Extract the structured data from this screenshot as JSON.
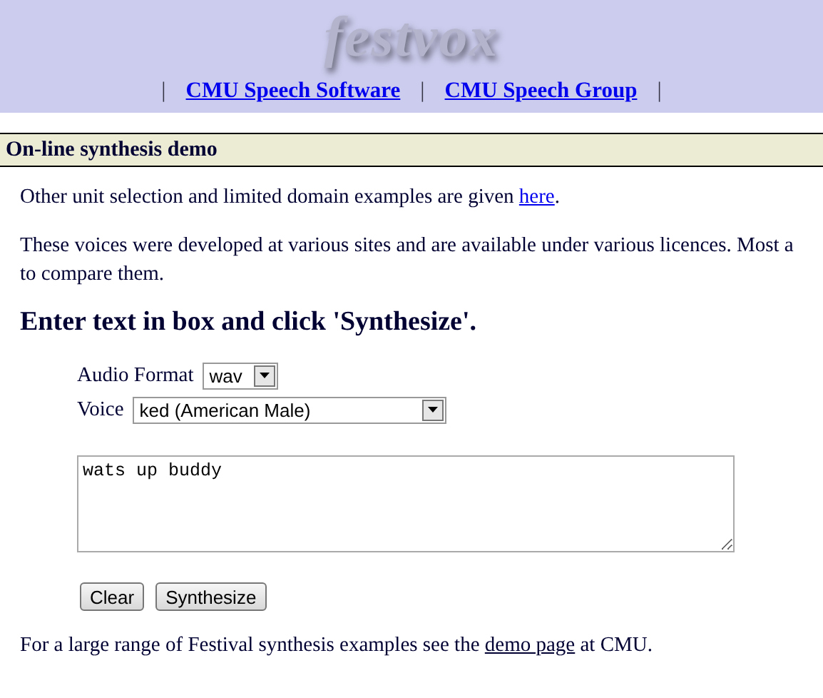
{
  "header": {
    "logo": "festvox",
    "nav": [
      {
        "kind": "separator",
        "text": "|"
      },
      {
        "kind": "link",
        "text": "CMU Speech Software"
      },
      {
        "kind": "separator",
        "text": "|"
      },
      {
        "kind": "link",
        "text": "CMU Speech Group"
      },
      {
        "kind": "separator",
        "text": "|"
      }
    ]
  },
  "section_title": "On-line synthesis demo",
  "intro": {
    "before": "Other unit selection and limited domain examples are given ",
    "link": "here",
    "after": "."
  },
  "paragraph_lines": [
    "These voices were developed at various sites and are available under various licences. Most a",
    "to compare them."
  ],
  "heading": "Enter text in box and click 'Synthesize'.",
  "form": {
    "audio_format": {
      "label": "Audio Format",
      "value": "wav"
    },
    "voice": {
      "label": "Voice",
      "value": "ked (American Male)"
    },
    "text": "wats up buddy",
    "buttons": [
      "Clear",
      "Synthesize"
    ]
  },
  "footer": {
    "before": "For a large range of Festival synthesis examples see the ",
    "link": "demo page",
    "after": " at CMU."
  }
}
